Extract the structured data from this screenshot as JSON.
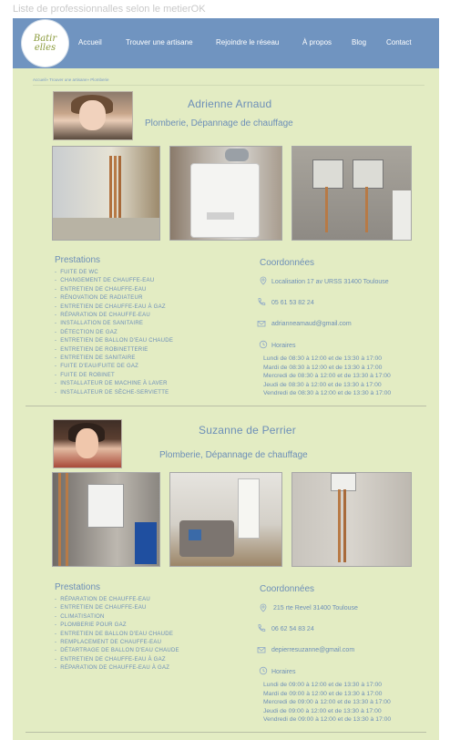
{
  "page_label": "Liste de professionnalles selon le metierOK",
  "logo_text": "Batir elles",
  "nav": [
    "Accueil",
    "Trouver une artisane",
    "Rejoindre le réseau",
    "À propos",
    "Blog",
    "Contact"
  ],
  "breadcrumb": "Accueil» Trouver une artisane» Plomberie",
  "profiles": [
    {
      "name": "Adrienne Arnaud",
      "job": "Plomberie, Dépannage de chauffage",
      "prestations_title": "Prestations",
      "prestations": [
        "Fuite de WC",
        "Changement de chauffe-eau",
        "Entretien de chauffe-eau",
        "Rénovation de radiateur",
        "Entretien de chauffe-eau à gaz",
        "Réparation de chauffe-eau",
        "Installation de sanitaire",
        "Détection de gaz",
        "Entretien de ballon d'eau chaude",
        "Entretien de robinetterie",
        "Entretien de sanitaire",
        "Fuite d'eau/Fuite de gaz",
        "Fuite de robinet",
        "Installateur de machine à laver",
        "Installateur de sèche-serviette"
      ],
      "coord_title": "Coordonnées",
      "address": "Localisation 17 av URSS 31400 Toulouse",
      "phone": "05 61 53 82 24",
      "email": "adrianneamaud@gmail.com",
      "hours_title": "Horaires",
      "hours": [
        "Lundi de 08:30 à 12:00 et de 13:30 à 17:00",
        "Mardi de 08:30 à 12:00 et de 13:30 à 17:00",
        "Mercredi de 08:30 à 12:00 et de 13:30 à 17:00",
        "Jeudi de 08:30 à 12:00 et de 13:30 à 17:00",
        "Vendredi de 08:30 à 12:00 et de 13:30 à 17:00"
      ]
    },
    {
      "name": "Suzanne de Perrier",
      "job": "Plomberie, Dépannage de chauffage",
      "prestations_title": "Prestations",
      "prestations": [
        "Réparation de chauffe-eau",
        "Entretien de chauffe-eau",
        "Climatisation",
        "Plomberie pour gaz",
        "Entretien de ballon d'eau chaude",
        "Remplacement de chauffe-eau",
        "Détartrage de ballon d'eau chaude",
        "Entretien de chauffe-eau à gaz",
        "Réparation de chauffe-eau à gaz"
      ],
      "coord_title": "Coordonnées",
      "address": "215 rte Revel 31400 Toulouse",
      "phone": "06 62 54 83 24",
      "email": "depierresuzanne@gmail.com",
      "hours_title": "Horaires",
      "hours": [
        "Lundi de 09:00 à 12:00 et de 13:30 à 17:00",
        "Mardi de 09:00 à 12:00 et de 13:30 à 17:00",
        "Mercredi de 09:00 à 12:00 et de 13:30 à 17:00",
        "Jeudi de 09:00 à 12:00 et de 13:30 à 17:00",
        "Vendredi de 09:00 à 12:00 et de 13:30 à 17:00"
      ]
    }
  ],
  "colors": {
    "nav_bg": "#7094c0",
    "page_bg": "#e3ecc3",
    "accent_text": "#6d8fb8"
  }
}
